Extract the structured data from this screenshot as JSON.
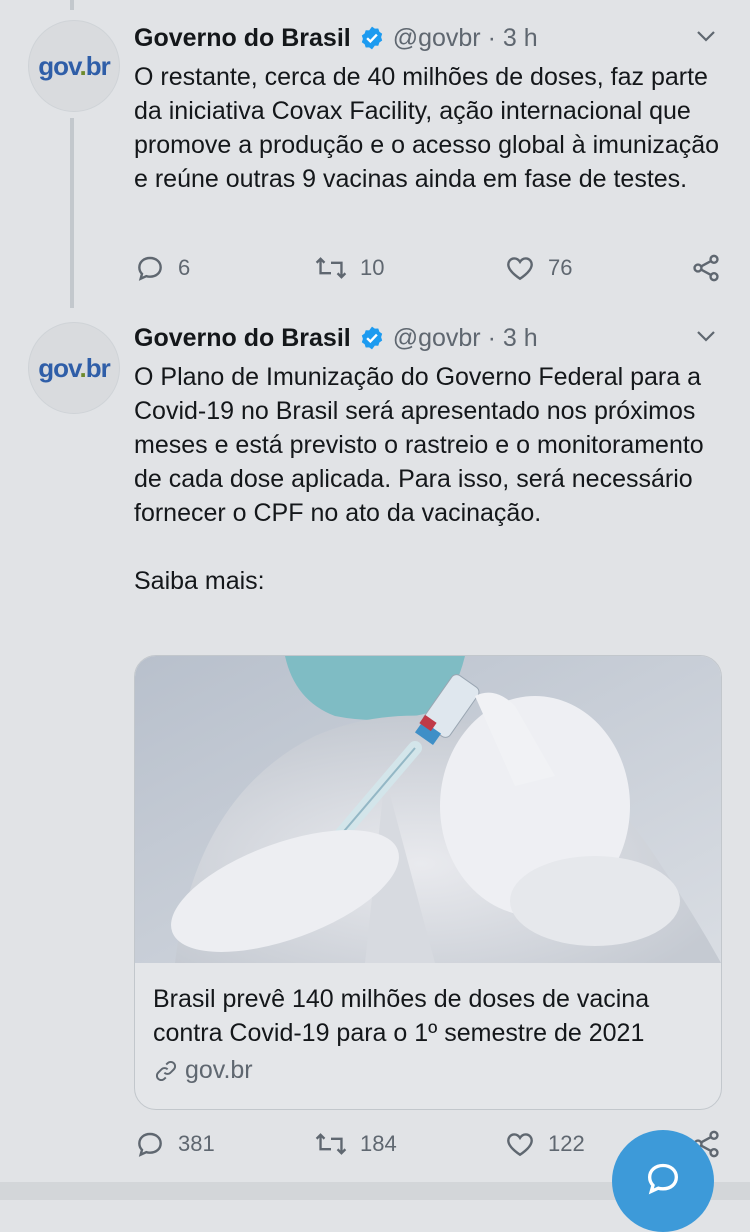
{
  "tweets": [
    {
      "author": "Governo do Brasil",
      "handle": "@govbr",
      "time": "3 h",
      "avatar_text": "gov.br",
      "text": "O restante, cerca de 40 milhões de doses, faz parte da iniciativa Covax Facility, ação internacional que promove a produção e o acesso global à imunização e reúne outras 9 vacinas ainda em fase de testes.",
      "replies": "6",
      "retweets": "10",
      "likes": "76"
    },
    {
      "author": "Governo do Brasil",
      "handle": "@govbr",
      "time": "3 h",
      "avatar_text": "gov.br",
      "text": "O Plano de Imunização do Governo Federal para a Covid-19 no Brasil será apresentado nos próximos meses e está previsto o rastreio e o monitoramento de cada dose aplicada. Para isso, será necessário fornecer o CPF no ato da vacinação.\n\nSaiba mais:",
      "replies": "381",
      "retweets": "184",
      "likes": "122",
      "card": {
        "title": "Brasil prevê 140 milhões de doses de vacina contra Covid-19 para o 1º semestre de 2021",
        "domain": "gov.br"
      }
    }
  ],
  "colors": {
    "accent": "#3d9ad9",
    "verified": "#1d9bf0",
    "muted": "#5f6770",
    "background": "#e1e3e6"
  }
}
